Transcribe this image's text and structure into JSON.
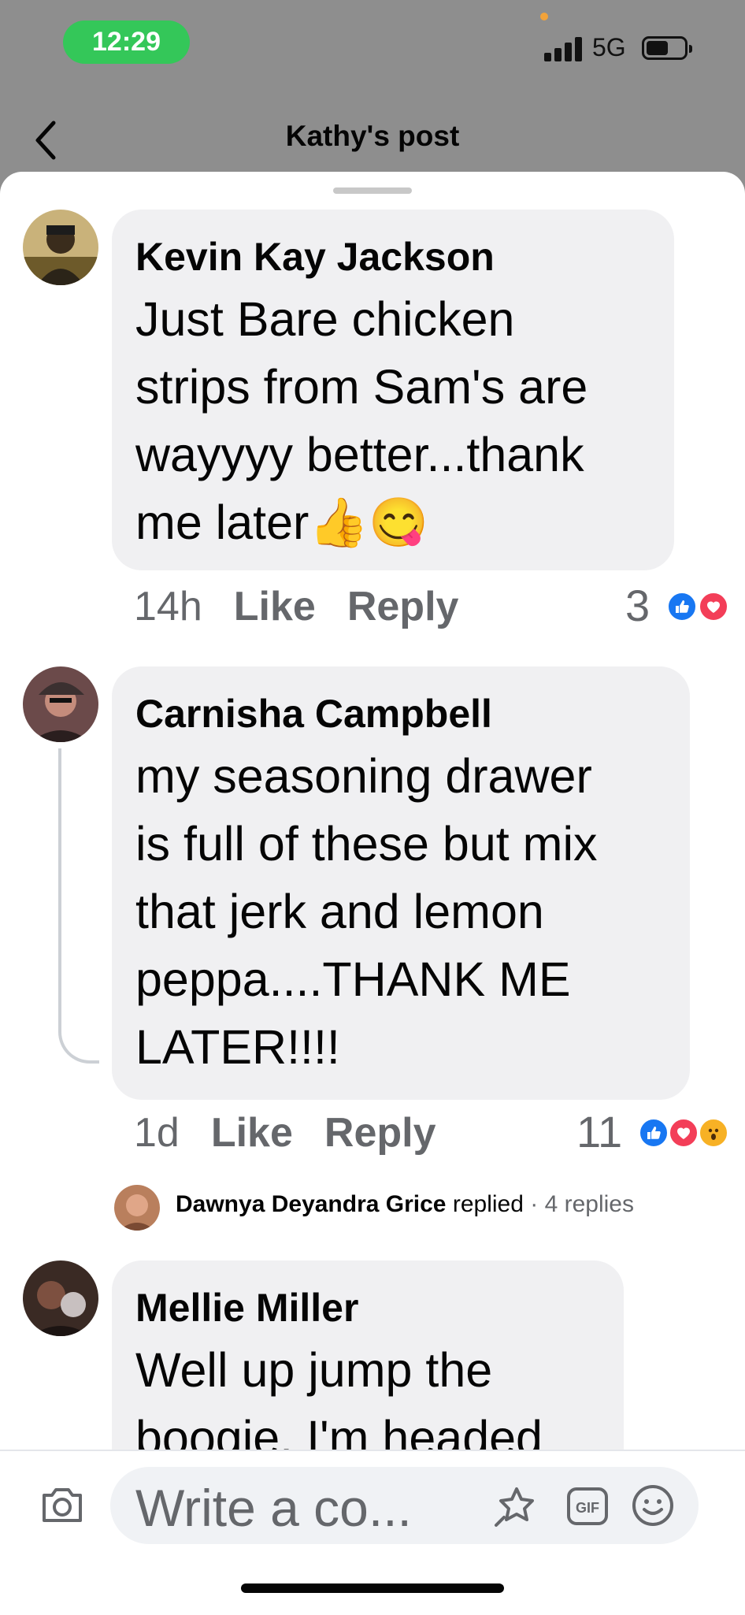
{
  "status": {
    "time": "12:29",
    "network": "5G"
  },
  "header": {
    "title": "Kathy's post"
  },
  "comments": [
    {
      "author": "Kevin Kay Jackson",
      "text_lines": [
        "Just Bare chicken",
        "strips from Sam's are",
        "wayyyy better...thank",
        "me later👍😋"
      ],
      "time": "14h",
      "like_label": "Like",
      "reply_label": "Reply",
      "reaction_count": "3",
      "reactions": [
        "like",
        "love"
      ]
    },
    {
      "author": "Carnisha Campbell",
      "text_lines": [
        "my seasoning drawer",
        "is full of these but mix",
        "that jerk and lemon",
        "peppa....THANK ME",
        "LATER!!!!"
      ],
      "time": "1d",
      "like_label": "Like",
      "reply_label": "Reply",
      "reaction_count": "11",
      "reactions": [
        "like",
        "love",
        "wow"
      ],
      "replies": {
        "name": "Dawnya Deyandra Grice",
        "action": "replied",
        "count_text": "· 4 replies"
      }
    },
    {
      "author": "Mellie Miller",
      "text_lines": [
        "Well up jump the",
        "boogie. I'm headed"
      ]
    }
  ],
  "composer": {
    "placeholder": "Write a co..."
  },
  "colors": {
    "like": "#1877f2",
    "love": "#f33e58",
    "wow": "#f7b125",
    "status_pill": "#34c759"
  },
  "icons": [
    "back-chevron-icon",
    "camera-icon",
    "sticker-icon",
    "gif-icon",
    "emoji-icon"
  ]
}
